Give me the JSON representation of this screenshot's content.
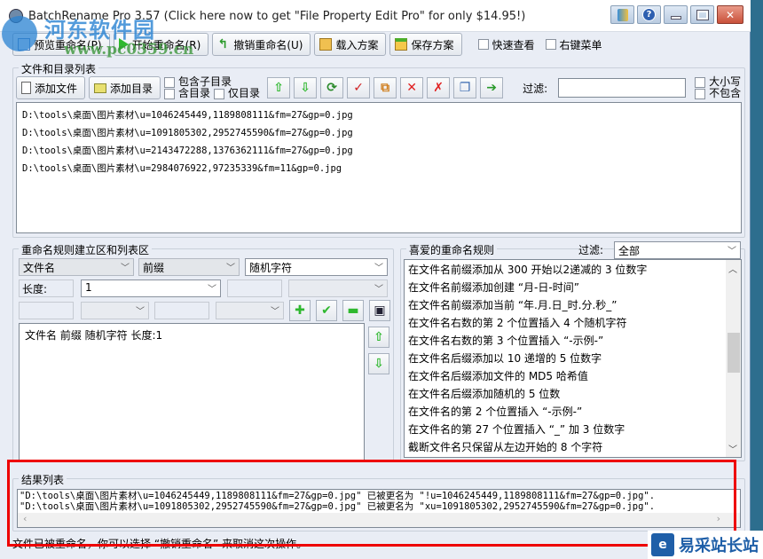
{
  "window": {
    "title": "BatchRename Pro 3.57  (Click here now to get \"File Property Edit Pro\" for only $14.95!)",
    "caption_buttons": [
      "app-icon",
      "help",
      "minimize",
      "maximize",
      "close"
    ]
  },
  "watermark": {
    "cn": "河东软件园",
    "url": "www.pc0359.cn"
  },
  "toolbar": {
    "preview": "预览重命名(P)",
    "start": "开始重命名(R)",
    "undo": "撤销重命名(U)",
    "load": "载入方案",
    "save": "保存方案",
    "quick_view": "快速查看",
    "context_menu": "右键菜单"
  },
  "files": {
    "group_label": "文件和目录列表",
    "add_file": "添加文件",
    "add_dir": "添加目录",
    "include_subdir": "包含子目录",
    "include_dirs": "含目录",
    "dirs_only": "仅目录",
    "filter_label": "过滤:",
    "filter_value": "",
    "case": "大小写",
    "exclude": "不包含",
    "items": [
      "D:\\tools\\桌面\\图片素材\\u=1046245449,1189808111&fm=27&gp=0.jpg",
      "D:\\tools\\桌面\\图片素材\\u=1091805302,2952745590&fm=27&gp=0.jpg",
      "D:\\tools\\桌面\\图片素材\\u=2143472288,1376362111&fm=27&gp=0.jpg",
      "D:\\tools\\桌面\\图片素材\\u=2984076922,97235339&fm=11&gp=0.jpg"
    ]
  },
  "rules": {
    "group_label": "重命名规则建立区和列表区",
    "target": "文件名",
    "position": "前缀",
    "type": "随机字符",
    "length_label": "长度:",
    "length_value": "1",
    "rule_list": [
      "文件名 前缀 随机字符 长度:1"
    ]
  },
  "favorites": {
    "group_label": "喜爱的重命名规则",
    "filter_label": "过滤:",
    "filter_value": "全部",
    "items": [
      "在文件名前缀添加从 300 开始以2递减的 3 位数字",
      "在文件名前缀添加创建 “月-日-时间”",
      "在文件名前缀添加当前 “年.月.日_时.分.秒_”",
      "在文件名右数的第 2 个位置插入 4 个随机字符",
      "在文件名右数的第 3 个位置插入 “-示例-”",
      "在文件名后缀添加以 10 递增的 5 位数字",
      "在文件名后缀添加文件的 MD5 哈希值",
      "在文件名后缀添加随机的 5 位数",
      "在文件名的第 2 个位置插入 “-示例-”",
      "在文件名的第 27 个位置插入 “_” 加 3 位数字",
      "截断文件名只保留从左边开始的 8 个字符"
    ],
    "scroll_position": 0.45
  },
  "results": {
    "group_label": "结果列表",
    "items": [
      "\"D:\\tools\\桌面\\图片素材\\u=1046245449,1189808111&fm=27&gp=0.jpg\" 已被更名为 \"!u=1046245449,1189808111&fm=27&gp=0.jpg\".",
      "\"D:\\tools\\桌面\\图片素材\\u=1091805302,2952745590&fm=27&gp=0.jpg\" 已被更名为 \"xu=1091805302,2952745590&fm=27&gp=0.jpg\"."
    ]
  },
  "status": {
    "text": "文件已被重命名，你可以选择 “撤销重命名” 来取消这次操作。"
  },
  "yicai": {
    "logo": "e",
    "text": "易采站长站"
  },
  "colors": {
    "highlight": "#ee0000",
    "accent_green": "#2fb82f"
  }
}
